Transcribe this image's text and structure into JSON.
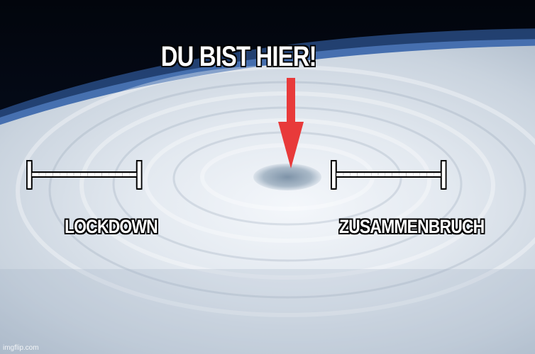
{
  "meme": {
    "title": "DU BIST HIER!",
    "left_bar": "|---------------|",
    "right_bar": "|---------------|",
    "left_label": "LOCKDOWN",
    "right_label": "ZUSAMMENBRUCH",
    "watermark": "imgflip.com"
  },
  "colors": {
    "arrow": "#e83a3a",
    "space": "#050a14",
    "cloud": "#e9eef4",
    "atmosphere": "#5f8fd8"
  },
  "icons": {
    "arrow": "down-arrow-icon"
  }
}
